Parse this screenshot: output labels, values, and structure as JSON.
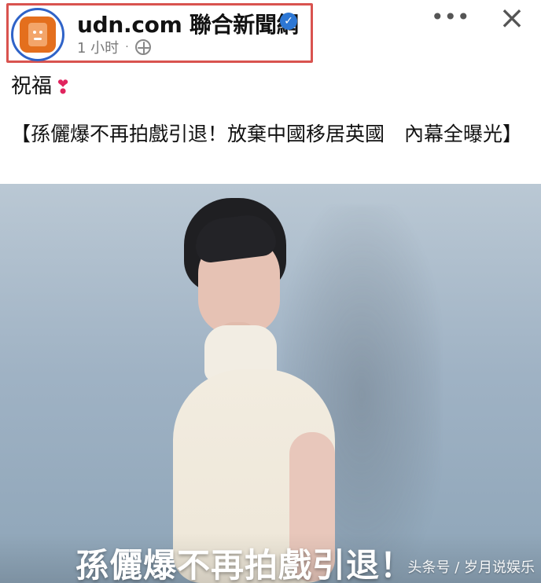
{
  "header": {
    "page_name": "udn.com 聯合新聞網",
    "time": "1 小时",
    "separator": "·",
    "verified_icon": "verified-badge-icon",
    "visibility_icon": "globe-icon",
    "more_icon": "more-options-icon",
    "close_icon": "close-icon",
    "more_label": "•••",
    "close_label": "×"
  },
  "post": {
    "greeting": "祝福",
    "greeting_emoji": "❣",
    "headline": "【孫儷爆不再拍戲引退！放棄中國移居英國　內幕全曝光】"
  },
  "media": {
    "caption": "孫儷爆不再拍戲引退！",
    "watermark": "头条号 / 岁月说娱乐"
  },
  "colors": {
    "highlight_border": "#d9534f",
    "avatar_ring": "#2f63c8",
    "avatar_fill": "#e46f1d",
    "verified_badge": "#2d77d4",
    "heart": "#e0245e",
    "text_primary": "#111111",
    "text_secondary": "#7a7a7a"
  }
}
